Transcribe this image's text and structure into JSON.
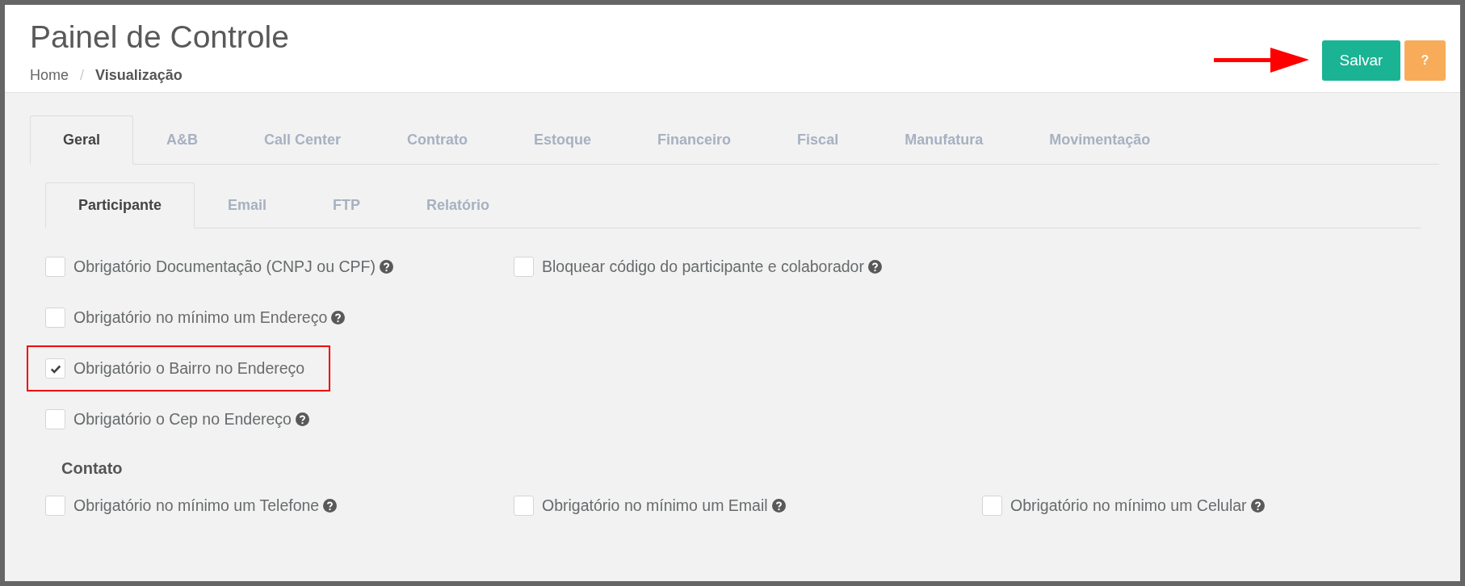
{
  "header": {
    "title": "Painel de Controle",
    "breadcrumb": [
      {
        "label": "Home",
        "current": false
      },
      {
        "label": "Visualização",
        "current": true
      }
    ],
    "separator": "/",
    "buttons": [
      {
        "kind": "save",
        "label": "Salvar"
      },
      {
        "kind": "help",
        "label": "?"
      }
    ]
  },
  "tabs": [
    {
      "label": "Geral",
      "selected": true
    },
    {
      "label": "A&B",
      "selected": false
    },
    {
      "label": "Call Center",
      "selected": false
    },
    {
      "label": "Contrato",
      "selected": false
    },
    {
      "label": "Estoque",
      "selected": false
    },
    {
      "label": "Financeiro",
      "selected": false
    },
    {
      "label": "Fiscal",
      "selected": false
    },
    {
      "label": "Manufatura",
      "selected": false
    },
    {
      "label": "Movimentação",
      "selected": false
    }
  ],
  "subtabs": [
    {
      "label": "Participante",
      "selected": true
    },
    {
      "label": "Email",
      "selected": false
    },
    {
      "label": "FTP",
      "selected": false
    },
    {
      "label": "Relatório",
      "selected": false
    }
  ],
  "sections": [
    {
      "rows": [
        [
          {
            "label": "Obrigatório Documentação (CNPJ ou CPF)",
            "checked": false,
            "help": true,
            "highlighted": false
          },
          {
            "label": "Bloquear código do participante e colaborador",
            "checked": false,
            "help": true,
            "highlighted": false
          }
        ],
        [
          {
            "label": "Obrigatório no mínimo um Endereço",
            "checked": false,
            "help": true,
            "highlighted": false
          }
        ],
        [
          {
            "label": "Obrigatório o Bairro no Endereço",
            "checked": true,
            "help": false,
            "highlighted": true
          }
        ],
        [
          {
            "label": "Obrigatório o Cep no Endereço",
            "checked": false,
            "help": true,
            "highlighted": false
          }
        ]
      ]
    },
    {
      "heading": "Contato",
      "rows": [
        [
          {
            "label": "Obrigatório no mínimo um Telefone",
            "checked": false,
            "help": true,
            "highlighted": false
          },
          {
            "label": "Obrigatório no mínimo um Email",
            "checked": false,
            "help": true,
            "highlighted": false
          },
          {
            "label": "Obrigatório no mínimo um Celular",
            "checked": false,
            "help": true,
            "highlighted": false
          }
        ]
      ]
    }
  ]
}
